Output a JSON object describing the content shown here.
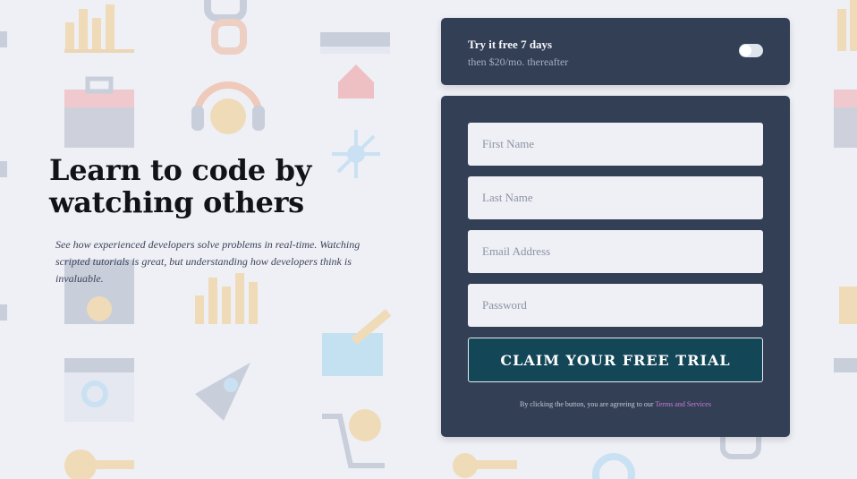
{
  "hero": {
    "title": "Learn to code by watching others",
    "description": "See how experienced developers solve problems in real-time. Watching scripted tutorials is great, but understanding how developers think is invaluable."
  },
  "trial": {
    "title": "Try it free 7 days",
    "subtitle": "then $20/mo. thereafter",
    "toggle_on": false
  },
  "form": {
    "first_name_placeholder": "First Name",
    "last_name_placeholder": "Last Name",
    "email_placeholder": "Email Address",
    "password_placeholder": "Password",
    "submit_label": "CLAIM YOUR FREE TRIAL",
    "terms_prefix": "By clicking the button, you are agreeing to our",
    "terms_link": "Terms and Services"
  },
  "background_icons": [
    "bar-chart-icon",
    "chain-link-icon",
    "toolbox-icon",
    "headset-icon",
    "browser-window-icon",
    "home-icon",
    "network-icon",
    "settings-window-icon",
    "pencil-icon",
    "rocket-icon",
    "search-window-icon",
    "cart-icon",
    "key-icon",
    "gear-icon"
  ],
  "colors": {
    "page_bg": "#eef0f6",
    "card_bg": "#333f55",
    "button_bg": "#134656",
    "link": "#c77fd5"
  }
}
